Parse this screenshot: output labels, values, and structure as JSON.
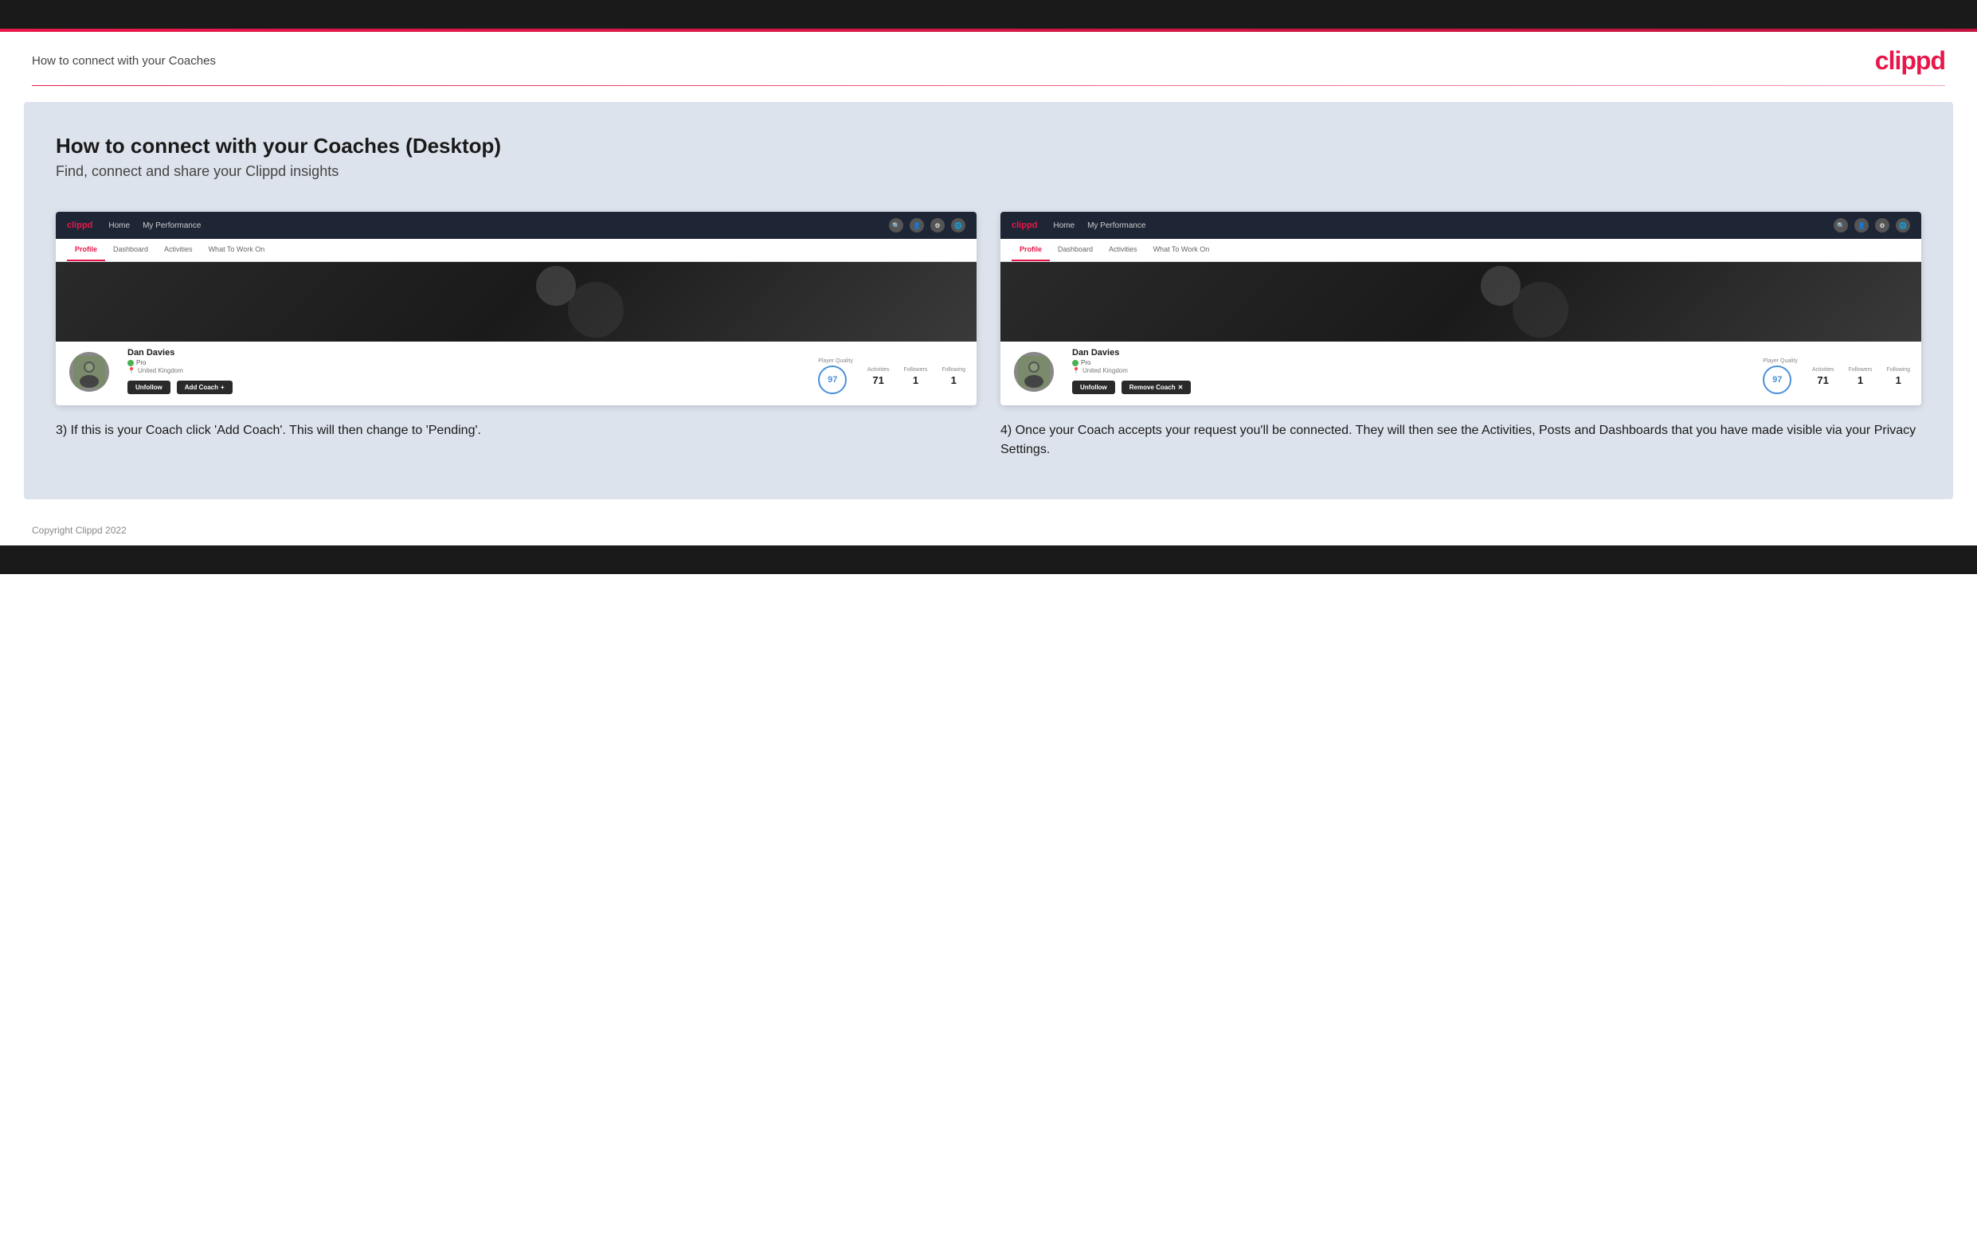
{
  "topBar": {},
  "accentLine": {},
  "header": {
    "title": "How to connect with your Coaches",
    "logo": "clippd"
  },
  "main": {
    "sectionTitle": "How to connect with your Coaches (Desktop)",
    "sectionSubtitle": "Find, connect and share your Clippd insights",
    "column1": {
      "mockNav": {
        "logo": "clippd",
        "items": [
          "Home",
          "My Performance"
        ]
      },
      "mockTabs": {
        "tabs": [
          "Profile",
          "Dashboard",
          "Activities",
          "What To Work On"
        ],
        "activeTab": "Profile"
      },
      "mockProfile": {
        "userName": "Dan Davies",
        "role": "Pro",
        "location": "United Kingdom",
        "stats": {
          "playerQualityLabel": "Player Quality",
          "playerQualityValue": "97",
          "activitiesLabel": "Activities",
          "activitiesValue": "71",
          "followersLabel": "Followers",
          "followersValue": "1",
          "followingLabel": "Following",
          "followingValue": "1"
        },
        "buttons": {
          "unfollow": "Unfollow",
          "addCoach": "Add Coach"
        }
      },
      "description": "3) If this is your Coach click 'Add Coach'. This will then change to 'Pending'."
    },
    "column2": {
      "mockNav": {
        "logo": "clippd",
        "items": [
          "Home",
          "My Performance"
        ]
      },
      "mockTabs": {
        "tabs": [
          "Profile",
          "Dashboard",
          "Activities",
          "What To Work On"
        ],
        "activeTab": "Profile"
      },
      "mockProfile": {
        "userName": "Dan Davies",
        "role": "Pro",
        "location": "United Kingdom",
        "stats": {
          "playerQualityLabel": "Player Quality",
          "playerQualityValue": "97",
          "activitiesLabel": "Activities",
          "activitiesValue": "71",
          "followersLabel": "Followers",
          "followersValue": "1",
          "followingLabel": "Following",
          "followingValue": "1"
        },
        "buttons": {
          "unfollow": "Unfollow",
          "removeCoach": "Remove Coach"
        }
      },
      "description": "4) Once your Coach accepts your request you'll be connected. They will then see the Activities, Posts and Dashboards that you have made visible via your Privacy Settings."
    }
  },
  "footer": {
    "copyright": "Copyright Clippd 2022"
  }
}
